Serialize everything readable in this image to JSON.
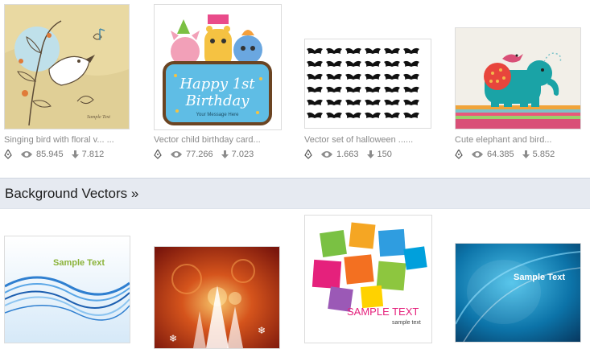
{
  "top_row": [
    {
      "caption": "Singing bird with floral v... ...",
      "views": "85.945",
      "downloads": "7.812"
    },
    {
      "caption": "Vector child birthday card...",
      "views": "77.266",
      "downloads": "7.023"
    },
    {
      "caption": "Vector set of halloween ......",
      "views": "1.663",
      "downloads": "150"
    },
    {
      "caption": "Cute elephant and bird...",
      "views": "64.385",
      "downloads": "5.852"
    }
  ],
  "section": {
    "title": "Background Vectors »"
  },
  "thumb_text": {
    "bird_sample": "Sample Text",
    "birthday_line1": "Happy 1st",
    "birthday_line2": "Birthday",
    "birthday_line3": "Your Message Here",
    "bg1_sample": "Sample Text",
    "bg3_sample": "SAMPLE TEXT",
    "bg3_sub": "sample text",
    "bg4_sample": "Sample Text"
  },
  "icons": {
    "author": "pen-nib-icon",
    "views": "eye-icon",
    "downloads": "download-arrow-icon"
  },
  "colors": {
    "band": "#e6eaf1",
    "caption": "#8a8a8a",
    "stats": "#777777"
  }
}
